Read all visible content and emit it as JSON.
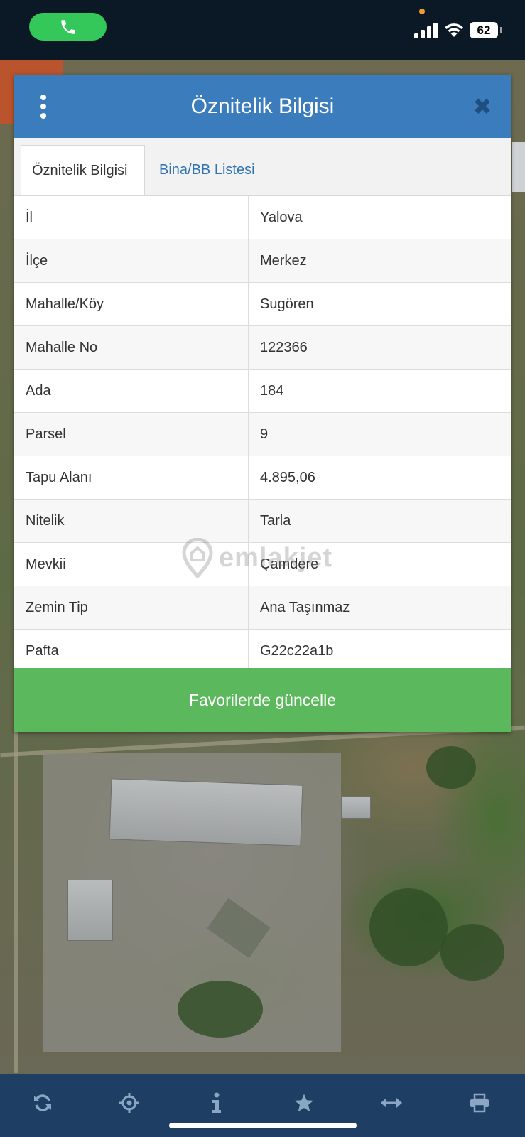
{
  "status_bar": {
    "battery": "62",
    "call_icon": "phone-icon",
    "signal_icon": "signal-icon",
    "wifi_icon": "wifi-icon"
  },
  "dialog": {
    "title": "Öznitelik Bilgisi",
    "menu_icon": "kebab-menu-icon",
    "close_label": "✖",
    "tabs": [
      {
        "label": "Öznitelik Bilgisi",
        "active": true
      },
      {
        "label": "Bina/BB Listesi",
        "active": false
      }
    ],
    "rows": [
      {
        "key": "İl",
        "value": "Yalova"
      },
      {
        "key": "İlçe",
        "value": "Merkez"
      },
      {
        "key": "Mahalle/Köy",
        "value": "Sugören"
      },
      {
        "key": "Mahalle No",
        "value": "122366"
      },
      {
        "key": "Ada",
        "value": "184"
      },
      {
        "key": "Parsel",
        "value": "9"
      },
      {
        "key": "Tapu Alanı",
        "value": "4.895,06"
      },
      {
        "key": "Nitelik",
        "value": "Tarla"
      },
      {
        "key": "Mevkii",
        "value": "Çamdere"
      },
      {
        "key": "Zemin Tip",
        "value": "Ana Taşınmaz"
      },
      {
        "key": "Pafta",
        "value": "G22c22a1b"
      }
    ],
    "favorite_button": "Favorilerde güncelle"
  },
  "watermark": "emlakjet",
  "toolbar": {
    "icons": [
      "refresh-icon",
      "locate-icon",
      "info-icon",
      "star-icon",
      "measure-icon",
      "print-icon"
    ]
  },
  "colors": {
    "header": "#3b7cbd",
    "button": "#5cb85c",
    "toolbar": "#1e3f63",
    "tab_link": "#2f73b3"
  }
}
